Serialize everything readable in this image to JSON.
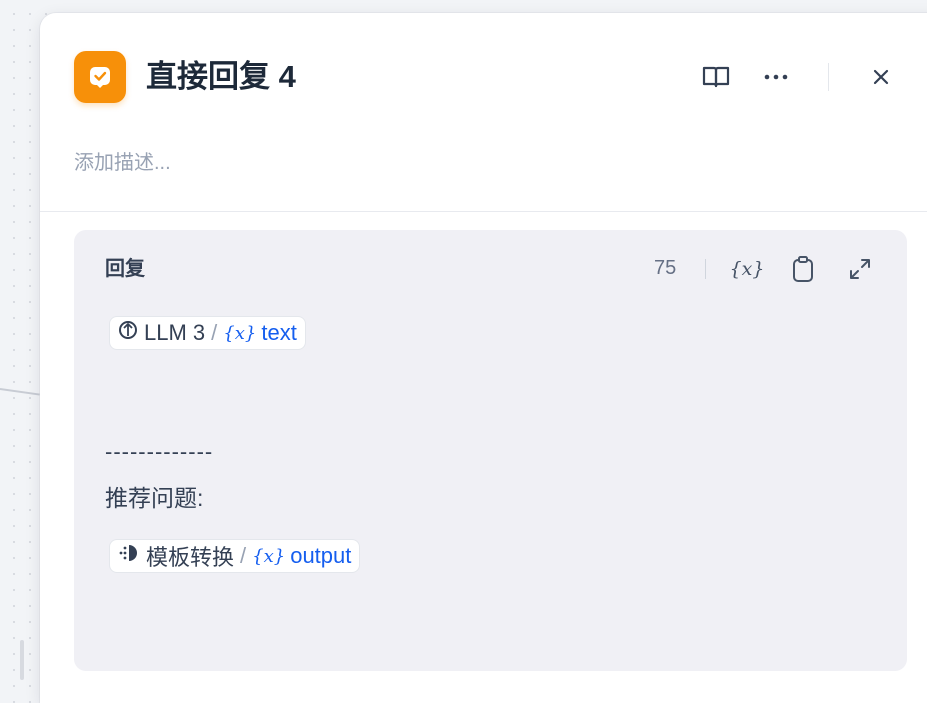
{
  "panel": {
    "title": "直接回复 4",
    "description_placeholder": "添加描述...",
    "header_icons": [
      "book-icon",
      "more-icon",
      "close-icon"
    ],
    "accent_color": "#f79009"
  },
  "editor": {
    "label": "回复",
    "char_count": "75",
    "toolbar_icons": [
      "variable-icon",
      "copy-icon",
      "expand-icon"
    ],
    "ref1": {
      "node": "LLM 3",
      "separator": "/",
      "var_icon_text": "{x}",
      "variable": "text"
    },
    "dash_line": "-------------",
    "suggest_label": "推荐问题:",
    "ref2": {
      "node": "模板转换",
      "separator": "/",
      "var_icon_text": "{x}",
      "variable": "output"
    },
    "variable_color": "#155eef"
  }
}
